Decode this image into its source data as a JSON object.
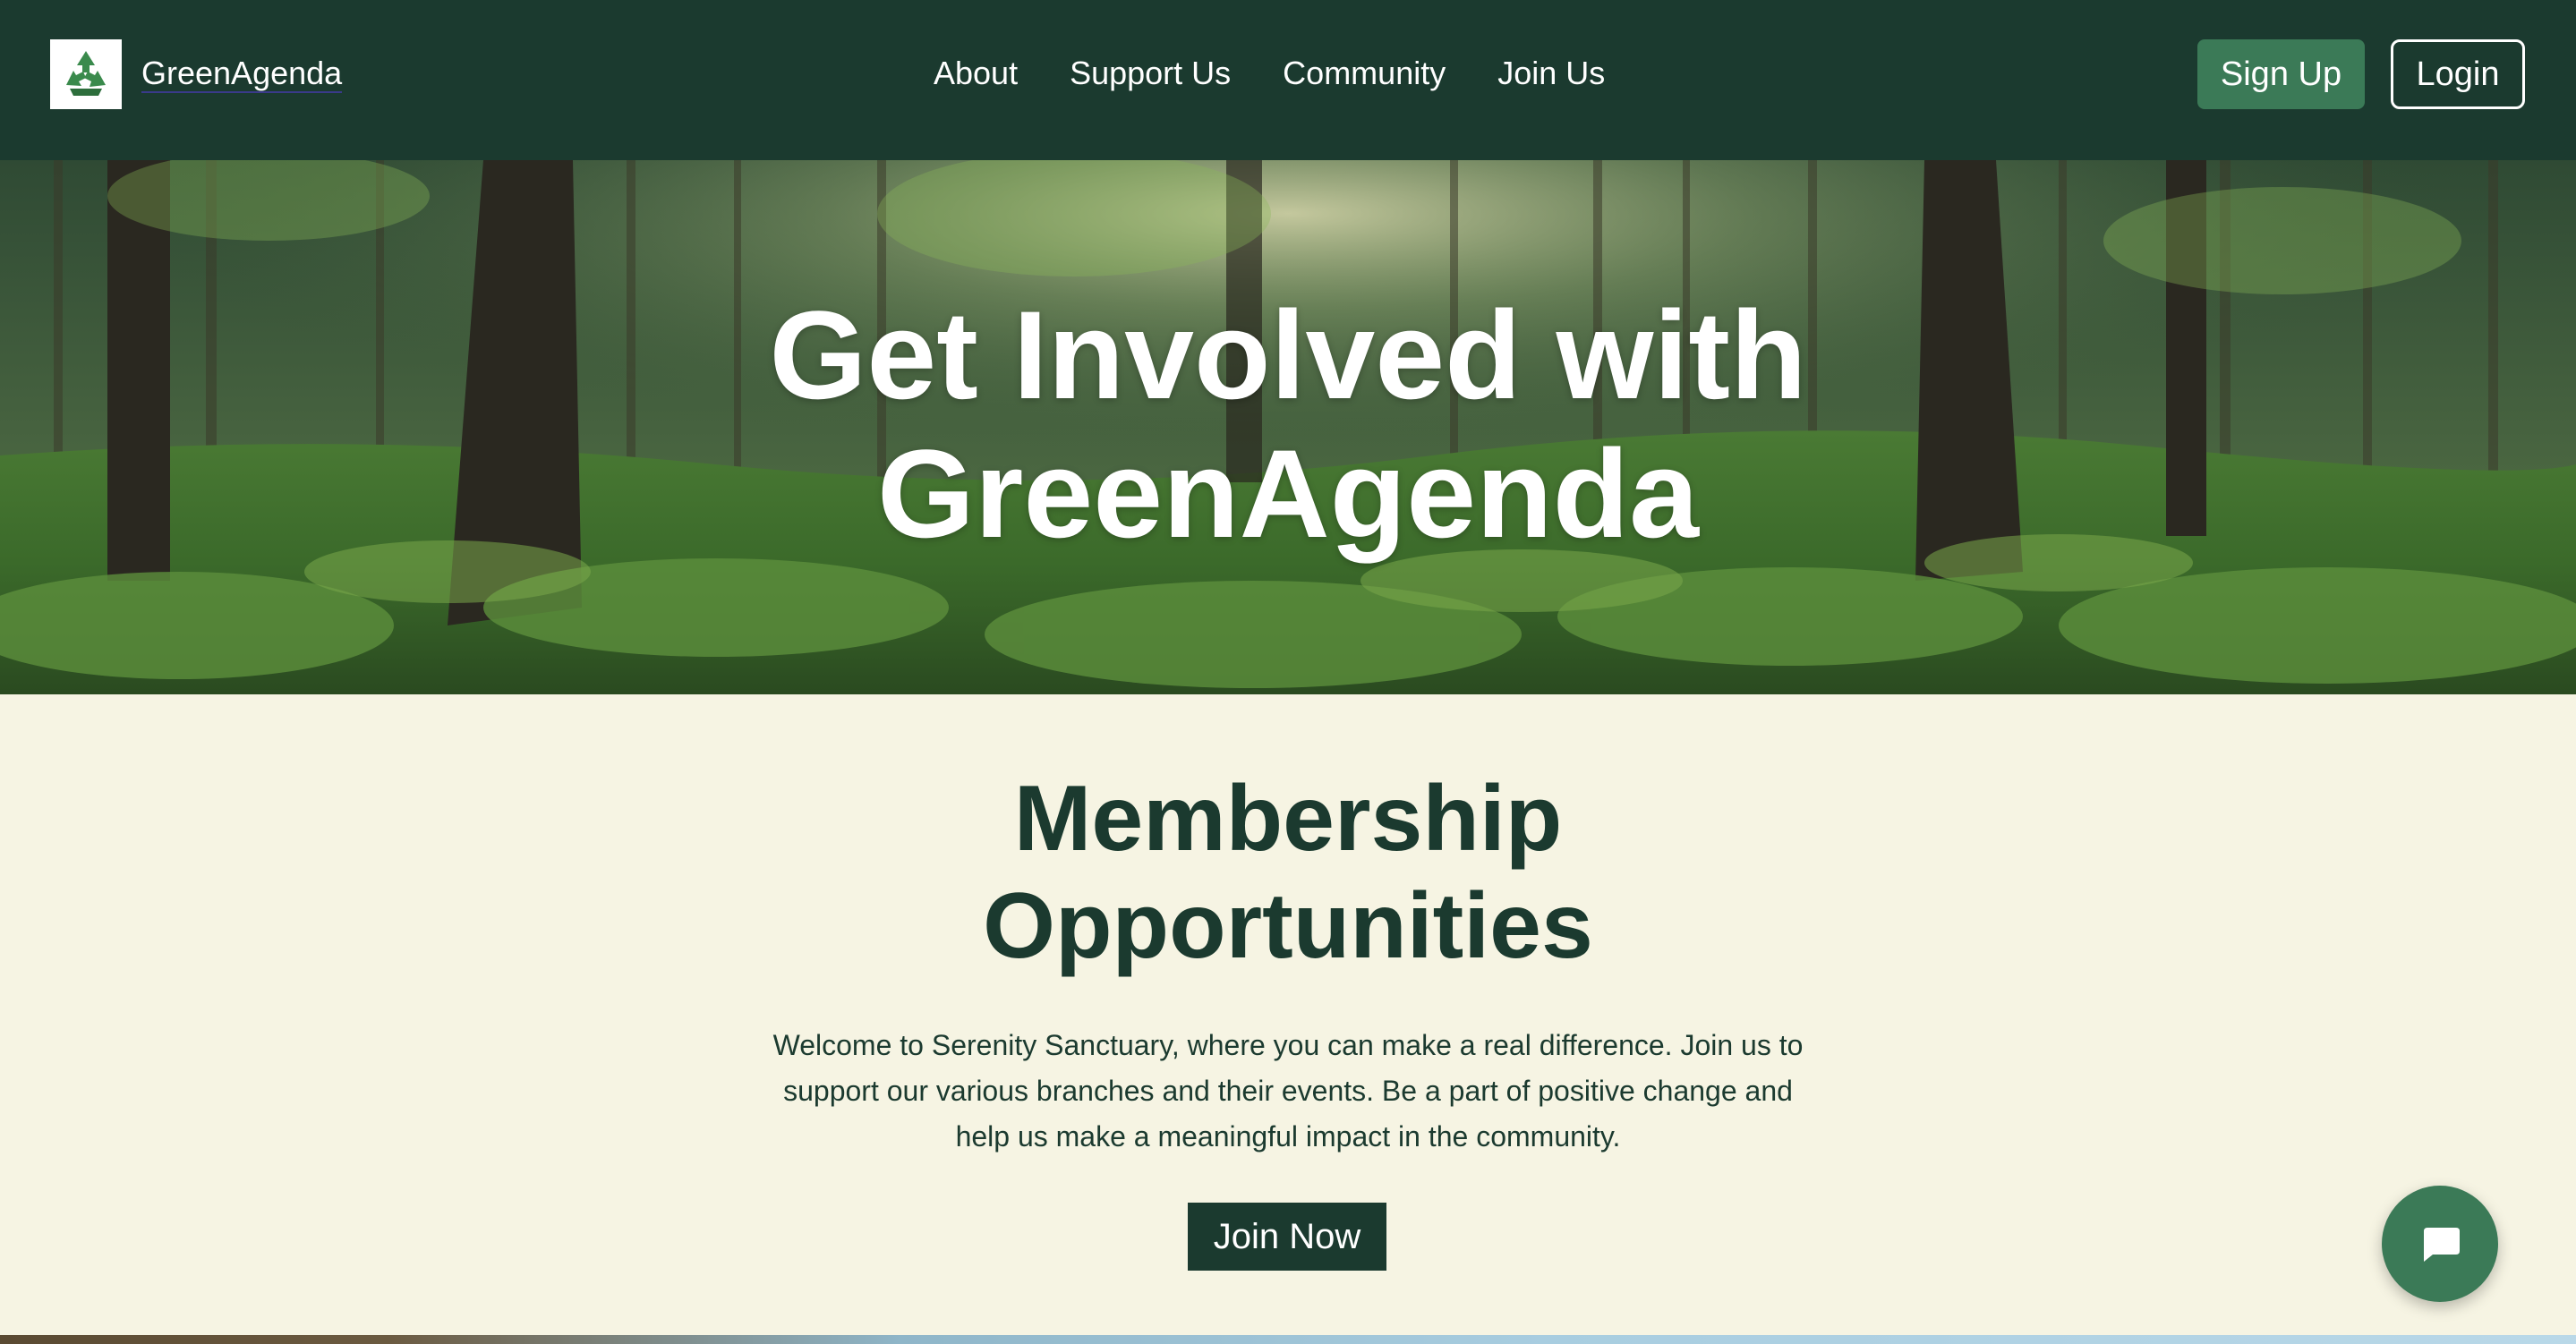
{
  "header": {
    "brand": "GreenAgenda",
    "logo_icon": "recycle-icon",
    "nav": [
      {
        "label": "About"
      },
      {
        "label": "Support Us"
      },
      {
        "label": "Community"
      },
      {
        "label": "Join Us"
      }
    ],
    "signup_label": "Sign Up",
    "login_label": "Login"
  },
  "hero": {
    "title_line1": "Get Involved with",
    "title_line2": "GreenAgenda",
    "background": "forest-image"
  },
  "membership": {
    "title_line1": "Membership",
    "title_line2": "Opportunities",
    "text_line1": "Welcome to Serenity Sanctuary, where you can make a real difference. Join us to",
    "text_line2": "support our various branches and their events. Be a part of positive change and",
    "text_line3": "help us make a meaningful impact in the community.",
    "cta_label": "Join Now"
  },
  "chat": {
    "icon": "chat-bubble-icon"
  },
  "colors": {
    "header_bg": "#1b3a2f",
    "accent": "#3b7a57",
    "section_bg": "#f6f4e3",
    "text_dark": "#1b3a2f"
  }
}
